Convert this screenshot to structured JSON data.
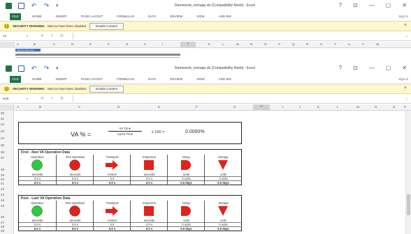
{
  "windows": [
    {
      "title": "Ramework_vsmapp.xls [Compatibility Mode] - Excel",
      "qat": [
        "excel-icon",
        "save-icon",
        "undo-icon",
        "redo-icon",
        "customize-icon"
      ],
      "controls": [
        "?",
        "⊡",
        "—",
        "▢",
        "✕"
      ],
      "tabs": [
        "FILE",
        "HOME",
        "INSERT",
        "PAGE LAYOUT",
        "FORMULAS",
        "DATA",
        "REVIEW",
        "VIEW",
        "ADD-INS"
      ],
      "signin": "Sign in",
      "message": {
        "title": "SECURITY WARNING",
        "text": "Macros have been disabled.",
        "button": "Enable Content"
      },
      "namebox": "J3",
      "columns": [
        "A",
        "B",
        "C",
        "D",
        "E",
        "F",
        "G",
        "H",
        "I",
        "J",
        "K",
        "L",
        "M",
        "N",
        "O",
        "P",
        "Q",
        "R",
        "S",
        "T",
        "U",
        "V",
        "W"
      ],
      "selected_cell_label": "Sample button text"
    },
    {
      "title": "Ramework_vsmapp.xls [Compatibility Mode] - Excel",
      "qat": [
        "excel-icon",
        "save-icon",
        "undo-icon",
        "redo-icon",
        "customize-icon"
      ],
      "controls": [
        "?",
        "⊡",
        "—",
        "▢",
        "✕"
      ],
      "tabs": [
        "FILE",
        "HOME",
        "INSERT",
        "PAGE LAYOUT",
        "FORMULAS",
        "DATA",
        "REVIEW",
        "VIEW",
        "ADD-INS"
      ],
      "signin": "Sign in",
      "message": {
        "title": "SECURITY WARNING",
        "text": "Macros have been disabled.",
        "button": "Enable Content"
      },
      "namebox": "H19",
      "columns": [
        "A",
        "B",
        "C",
        "D",
        "E",
        "F",
        "G",
        "H",
        "I",
        "J",
        "K",
        "L",
        "M",
        "N",
        "O",
        "P"
      ]
    }
  ],
  "rows": [
    "30",
    "31",
    "32",
    "33",
    "34",
    "35",
    "36",
    "37",
    "38",
    "39",
    "40",
    "41",
    "42",
    "43",
    "44",
    "45",
    "46",
    "47",
    "48",
    "49"
  ],
  "va": {
    "label": "VA % =",
    "numerator": "VA Time",
    "denominator": "Cycle-Time",
    "multiplier": "x 100 =",
    "result": "0.0000%"
  },
  "sections": [
    {
      "title": "First - Non VA Operation Data",
      "ops": [
        {
          "name": "Operation",
          "unit": "seconds",
          "value": "0.0 s",
          "total": "0.0 s",
          "shape": "circle",
          "color": "#2ecc40"
        },
        {
          "name": "NVA Operation",
          "unit": "seconds",
          "value": "0.0 s",
          "total": "0.0 s",
          "shape": "circle",
          "color": "#e0221c"
        },
        {
          "name": "Transport",
          "unit": "metres",
          "value": "0.0",
          "total": "0.0 s",
          "shape": "arrow",
          "color": "#e0221c"
        },
        {
          "name": "Inspection",
          "unit": "seconds",
          "value": "0.0 s",
          "total": "0.0 s",
          "shape": "square",
          "color": "#e0221c"
        },
        {
          "name": "Delay",
          "unit": "units",
          "value": "0 units",
          "total": "0.0 days",
          "shape": "delay",
          "color": "#e0221c"
        },
        {
          "name": "Storage",
          "unit": "units",
          "value": "0 units",
          "total": "0.0 days",
          "shape": "triangle",
          "color": "#e0221c"
        }
      ]
    },
    {
      "title": "Post - Last VA Operation Data",
      "ops": [
        {
          "name": "Operation",
          "unit": "seconds",
          "value": "0.0 s",
          "total": "0.0 s",
          "shape": "circle",
          "color": "#2ecc40"
        },
        {
          "name": "NVA Operation",
          "unit": "seconds",
          "value": "0.0 s",
          "total": "0.0 s",
          "shape": "circle",
          "color": "#e0221c"
        },
        {
          "name": "Transport",
          "unit": "metres",
          "value": "0.0",
          "total": "0.0 s",
          "shape": "arrow",
          "color": "#e0221c"
        },
        {
          "name": "Inspection",
          "unit": "seconds",
          "value": "0.0 s",
          "total": "0.0 s",
          "shape": "square",
          "color": "#e0221c"
        },
        {
          "name": "Delay",
          "unit": "units",
          "value": "0 units",
          "total": "0.0 days",
          "shape": "delay",
          "color": "#e0221c"
        },
        {
          "name": "Storage",
          "unit": "units",
          "value": "0 units",
          "total": "0.0 days",
          "shape": "triangle",
          "color": "#e0221c"
        }
      ]
    }
  ]
}
